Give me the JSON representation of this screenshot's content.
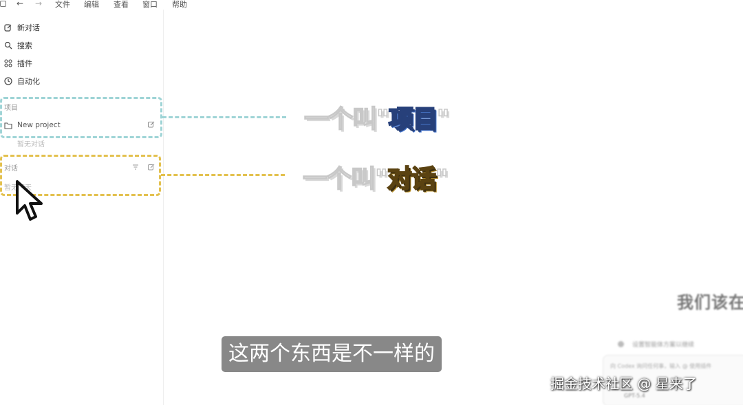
{
  "menubar": {
    "items": [
      "文件",
      "编辑",
      "查看",
      "窗口",
      "帮助"
    ]
  },
  "sidebar": {
    "nav": [
      {
        "label": "新对话",
        "icon": "edit-icon"
      },
      {
        "label": "搜索",
        "icon": "search-icon"
      },
      {
        "label": "插件",
        "icon": "plugin-icon"
      },
      {
        "label": "自动化",
        "icon": "clock-icon"
      }
    ],
    "projects_label": "项目",
    "project": {
      "name": "New project",
      "icon": "folder-icon"
    },
    "project_empty": "暂无对话",
    "conversations_label": "对话",
    "conversations_empty": "暂无聊天"
  },
  "annotations": {
    "project_prefix": "一个叫\"",
    "project_word": "项目",
    "project_suffix": "\"",
    "conversation_prefix": "一个叫\"",
    "conversation_word": "对话",
    "conversation_suffix": "\"",
    "project_color": "#9fd4d6",
    "conversation_color": "#e3c14f"
  },
  "main": {
    "heading": "我们该在",
    "suggestion": "设置智能体方案以继续",
    "input_placeholder": "向 Codex 询问任何事，输入 @ 使用插件",
    "model": "GPT-5.4"
  },
  "subtitle": "这两个东西是不一样的",
  "watermark": "掘金技术社区 @ 星来了"
}
